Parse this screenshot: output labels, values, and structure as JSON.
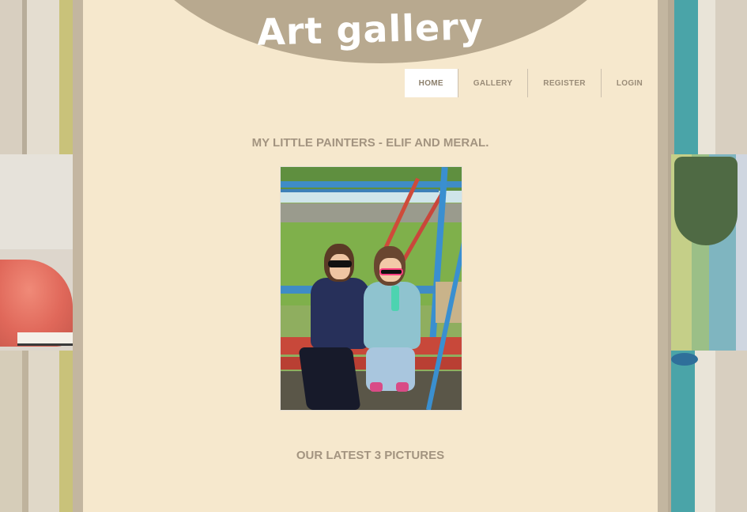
{
  "site": {
    "title": "Art gallery"
  },
  "nav": {
    "items": [
      {
        "label": "HOME",
        "active": true
      },
      {
        "label": "GALLERY",
        "active": false
      },
      {
        "label": "REGISTER",
        "active": false
      },
      {
        "label": "LOGIN",
        "active": false
      }
    ]
  },
  "main": {
    "heading": "MY LITTLE PAINTERS - ELIF AND MERAL.",
    "latest_heading": "OUR LATEST 3 PICTURES"
  },
  "colors": {
    "page_background": "#faecd0",
    "header_arc": "#b8a98f",
    "heading_text": "#a39480",
    "nav_active_bg": "#ffffff"
  }
}
